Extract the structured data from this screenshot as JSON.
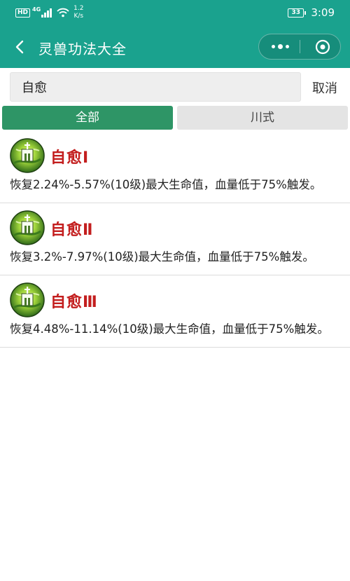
{
  "status_bar": {
    "hd": "HD",
    "network": "4G",
    "speed_value": "1.2",
    "speed_unit": "K/s",
    "battery": "33",
    "time": "3:09"
  },
  "nav": {
    "title": "灵兽功法大全",
    "back_icon": "chevron-left-icon",
    "more_icon": "more-dots-icon",
    "close_icon": "target-circle-icon"
  },
  "search": {
    "value": "自愈",
    "cancel_label": "取消"
  },
  "tabs": [
    {
      "label": "全部",
      "active": true
    },
    {
      "label": "川式",
      "active": false
    }
  ],
  "skills": [
    {
      "name": "自愈Ⅰ",
      "desc": "恢复2.24%-5.57%(10级)最大生命值，血量低于75%触发。",
      "icon": "heal-skill-icon"
    },
    {
      "name": "自愈Ⅱ",
      "desc": "恢复3.2%-7.97%(10级)最大生命值，血量低于75%触发。",
      "icon": "heal-skill-icon"
    },
    {
      "name": "自愈Ⅲ",
      "desc": "恢复4.48%-11.14%(10级)最大生命值，血量低于75%触发。",
      "icon": "heal-skill-icon"
    }
  ],
  "colors": {
    "header_green": "#1aa28e",
    "tab_active": "#2e9566",
    "skill_name_red": "#c31e1e"
  }
}
